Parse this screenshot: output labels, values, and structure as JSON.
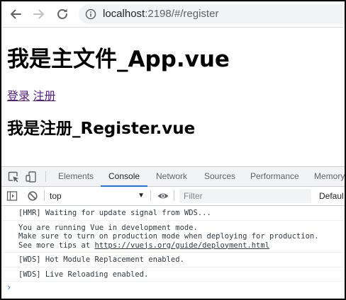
{
  "browser": {
    "url_host": "localhost",
    "url_rest": ":2198/#/register"
  },
  "page": {
    "heading": "我是主文件_App.vue",
    "links": [
      {
        "label": "登录"
      },
      {
        "label": "注册"
      }
    ],
    "subheading": "我是注册_Register.vue"
  },
  "devtools": {
    "tabs": [
      "Elements",
      "Console",
      "Network",
      "Sources",
      "Performance",
      "Memory"
    ],
    "active_tab": "Console",
    "toolbar": {
      "context": "top",
      "filter_placeholder": "Filter",
      "levels_label": "Defaul"
    },
    "messages": [
      {
        "lines": [
          "[HMR] Waiting for update signal from WDS..."
        ]
      },
      {
        "lines": [
          "You are running Vue in development mode.",
          "Make sure to turn on production mode when deploying for production."
        ],
        "tip_prefix": "See more tips at ",
        "tip_link": "https://vuejs.org/guide/deployment.html"
      },
      {
        "lines": [
          "[WDS] Hot Module Replacement enabled."
        ]
      },
      {
        "lines": [
          "[WDS] Live Reloading enabled."
        ]
      }
    ],
    "prompt_symbol": "›"
  },
  "colors": {
    "accent": "#1a73e8",
    "visited_link": "#551a8b",
    "toolbar_bg": "#f1f3f4"
  }
}
